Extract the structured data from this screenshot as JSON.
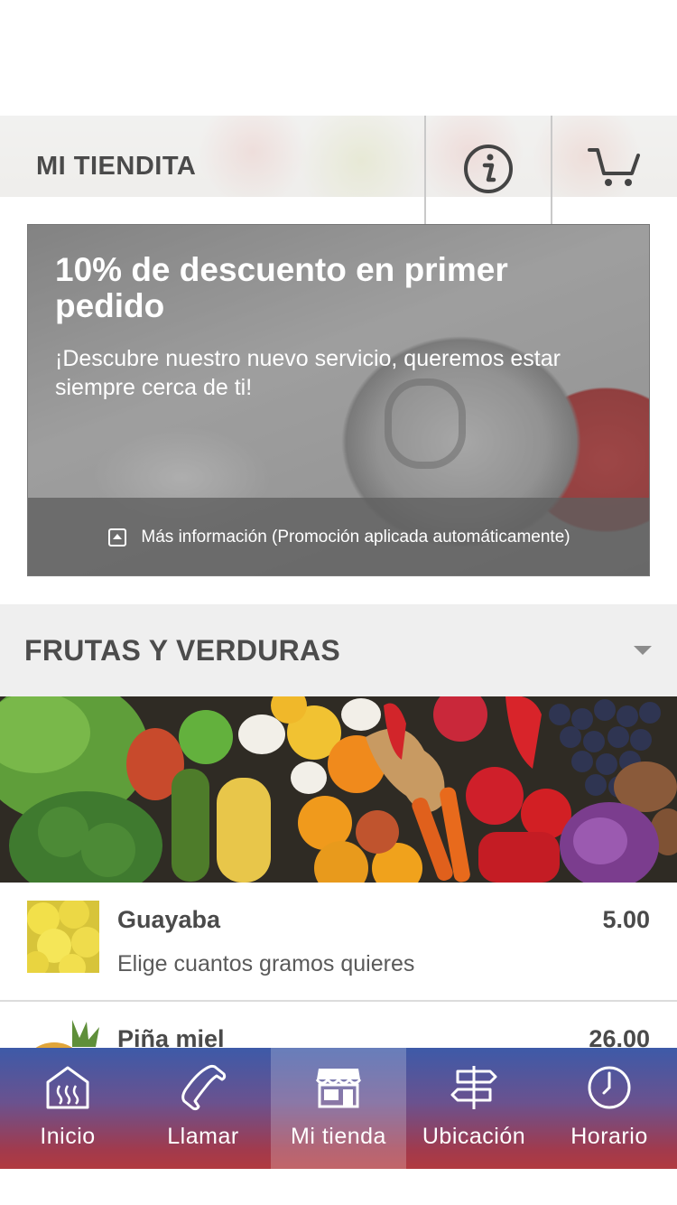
{
  "header": {
    "title": "MI TIENDITA",
    "info_icon": "info-icon",
    "cart_icon": "cart-icon"
  },
  "promo": {
    "title": "10% de descuento en primer pedido",
    "text": "¡Descubre nuestro nuevo servicio, queremos estar siempre cerca de ti!",
    "more_info": "Más información (Promoción aplicada automáticamente)"
  },
  "category": {
    "title": "FRUTAS Y VERDURAS",
    "expand_icon": "chevron-down-icon"
  },
  "products": [
    {
      "name": "Guayaba",
      "price": "5.00",
      "description": "Elige cuantos gramos quieres"
    },
    {
      "name": "Piña miel",
      "price": "26.00",
      "description": ""
    }
  ],
  "nav": {
    "items": [
      {
        "label": "Inicio",
        "icon": "home-icon"
      },
      {
        "label": "Llamar",
        "icon": "phone-icon"
      },
      {
        "label": "Mi tienda",
        "icon": "store-icon",
        "active": true
      },
      {
        "label": "Ubicación",
        "icon": "signpost-icon"
      },
      {
        "label": "Horario",
        "icon": "clock-icon"
      }
    ]
  },
  "colors": {
    "nav_top": "#3d5aa8",
    "nav_bottom": "#b13a40",
    "category_bg": "#efefef",
    "text_dark": "#4a4a4a"
  }
}
